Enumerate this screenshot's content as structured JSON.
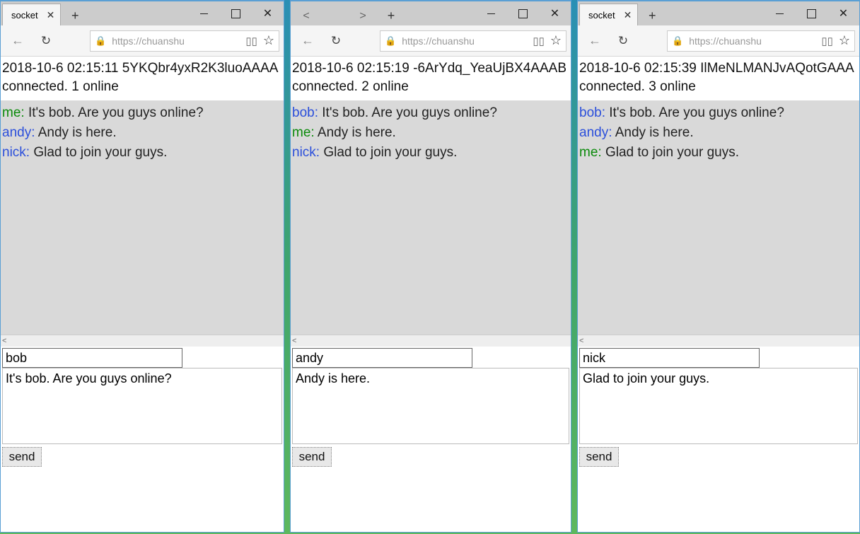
{
  "windows": [
    {
      "tab_label": "socket",
      "show_tab": true,
      "show_back_tab": false,
      "show_fwd_tab": false,
      "url": "https://chuanshu",
      "status_line1": "2018-10-6 02:15:11 5YKQbr4yxR2K3luoAAAA",
      "status_line2": "connected. 1 online",
      "messages": [
        {
          "sender": "me",
          "self": true,
          "text": "It's bob. Are you guys online?"
        },
        {
          "sender": "andy",
          "self": false,
          "text": "Andy is here."
        },
        {
          "sender": "nick",
          "self": false,
          "text": "Glad to join your guys."
        }
      ],
      "name_value": "bob",
      "msg_value": "It's bob. Are you guys online?",
      "send_label": "send"
    },
    {
      "tab_label": "",
      "show_tab": false,
      "show_back_tab": true,
      "show_fwd_tab": true,
      "url": "https://chuanshu",
      "status_line1": "2018-10-6 02:15:19 -6ArYdq_YeaUjBX4AAAB",
      "status_line2": "connected. 2 online",
      "messages": [
        {
          "sender": "bob",
          "self": false,
          "text": "It's bob. Are you guys online?"
        },
        {
          "sender": "me",
          "self": true,
          "text": "Andy is here."
        },
        {
          "sender": "nick",
          "self": false,
          "text": "Glad to join your guys."
        }
      ],
      "name_value": "andy",
      "msg_value": "Andy is here.",
      "send_label": "send"
    },
    {
      "tab_label": "socket",
      "show_tab": true,
      "show_back_tab": false,
      "show_fwd_tab": false,
      "url": "https://chuanshu",
      "status_line1": "2018-10-6 02:15:39 IlMeNLMANJvAQotGAAA",
      "status_line2": "connected. 3 online",
      "messages": [
        {
          "sender": "bob",
          "self": false,
          "text": "It's bob. Are you guys online?"
        },
        {
          "sender": "andy",
          "self": false,
          "text": "Andy is here."
        },
        {
          "sender": "me",
          "self": true,
          "text": "Glad to join your guys."
        }
      ],
      "name_value": "nick",
      "msg_value": "Glad to join your guys.",
      "send_label": "send"
    }
  ]
}
